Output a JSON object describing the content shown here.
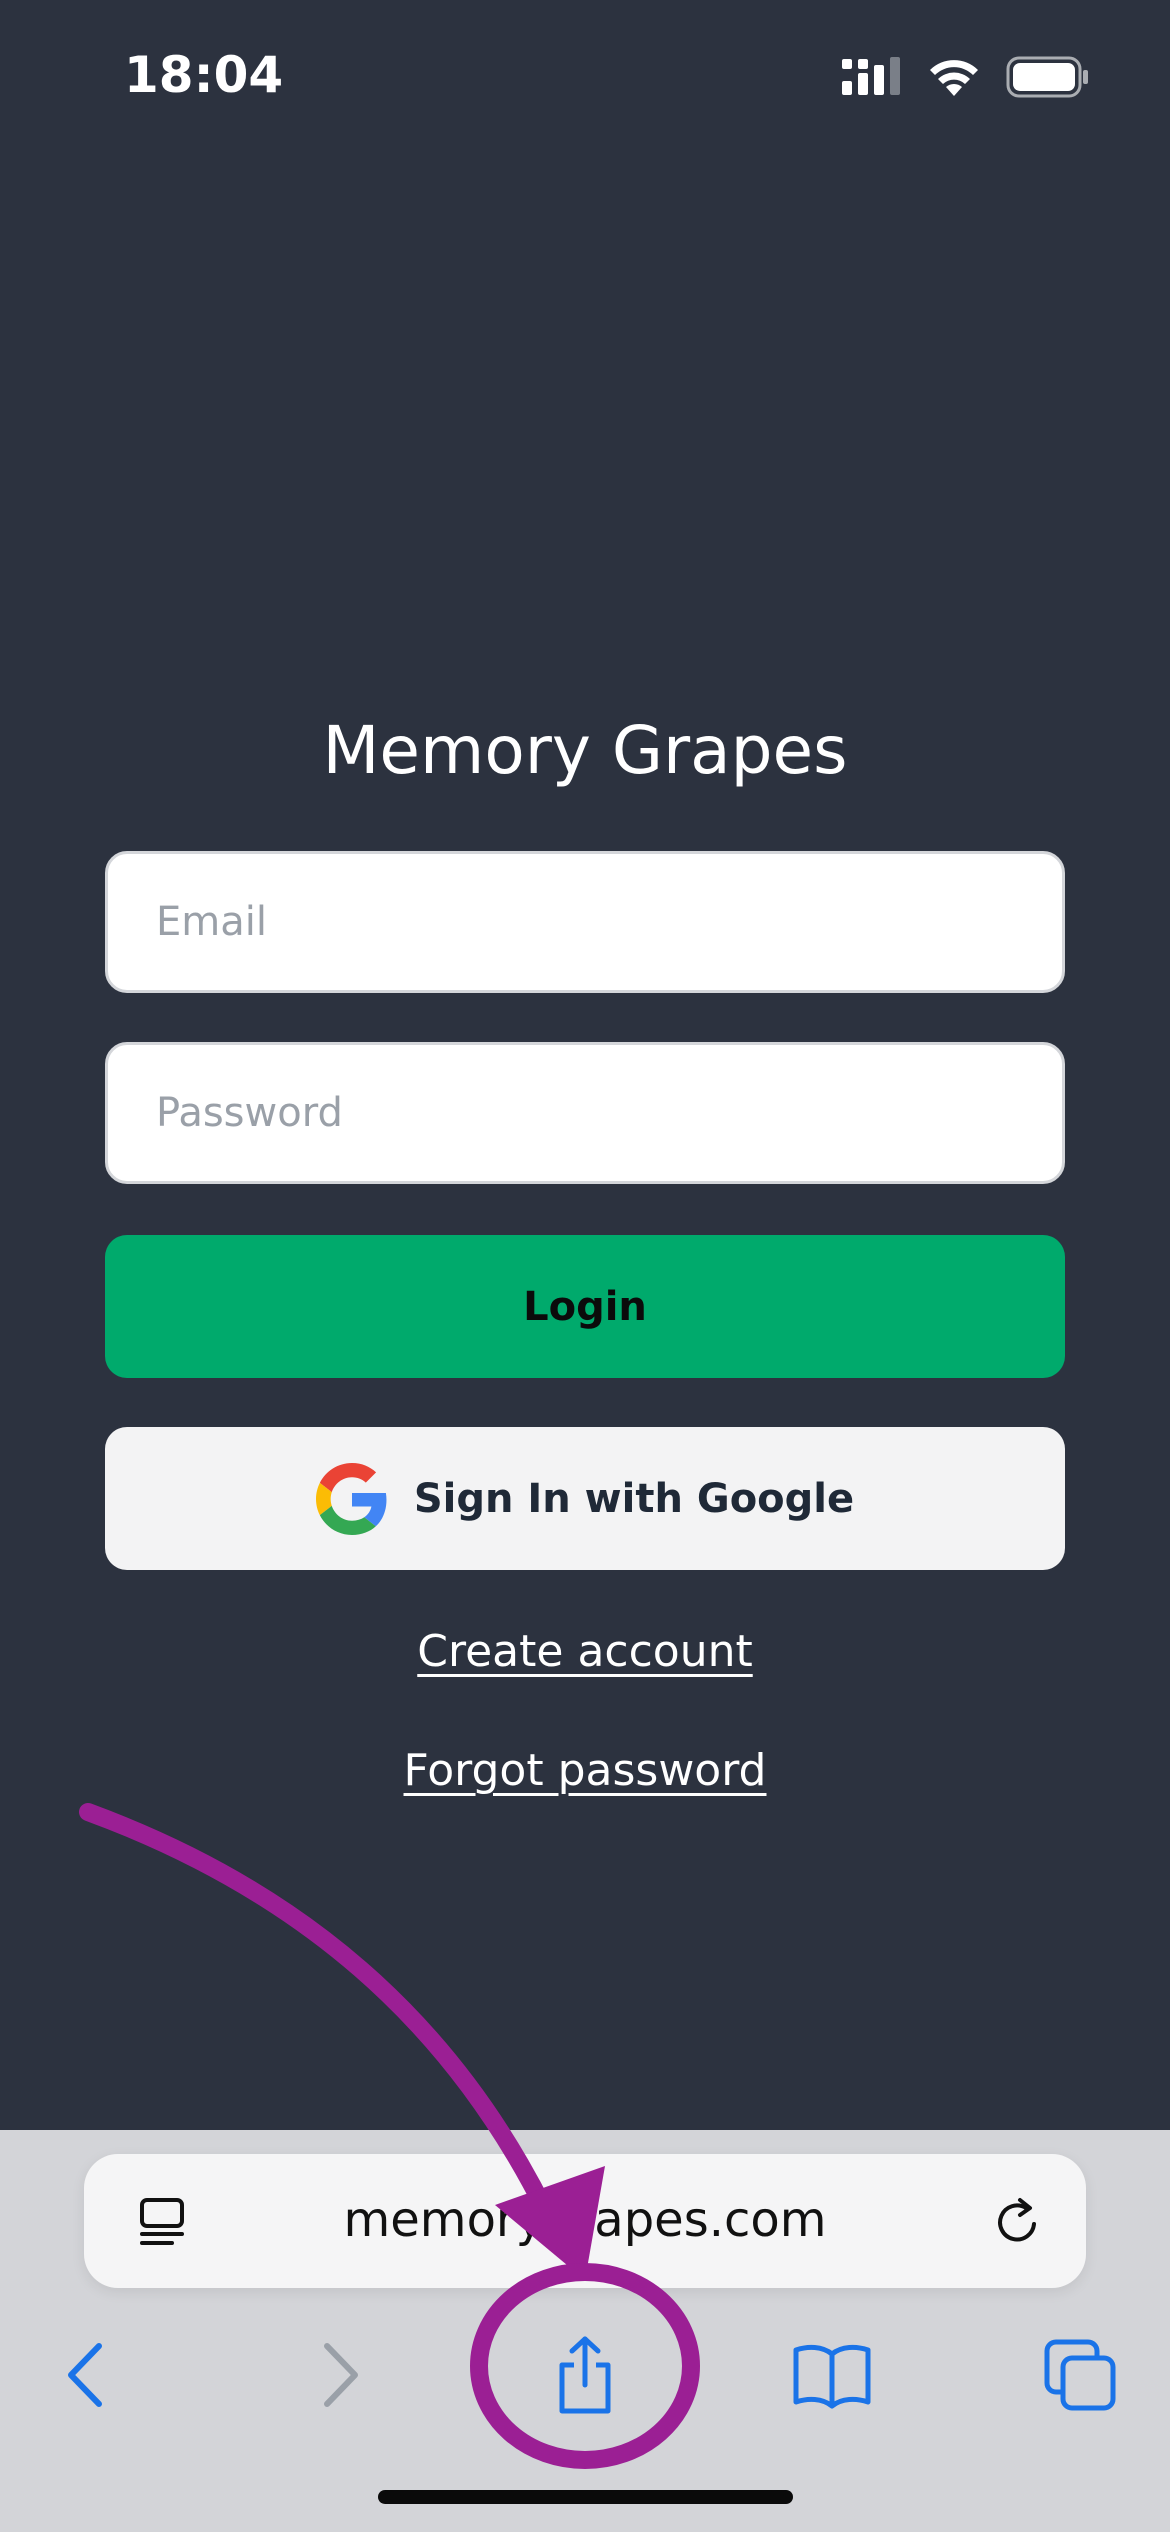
{
  "status_bar": {
    "time": "18:04"
  },
  "app": {
    "title": "Memory Grapes"
  },
  "form": {
    "email_placeholder": "Email",
    "email_value": "",
    "password_placeholder": "Password",
    "password_value": "",
    "login_label": "Login",
    "google_label": "Sign In with Google",
    "create_account_label": "Create account",
    "forgot_password_label": "Forgot password"
  },
  "browser": {
    "url": "memorygrapes.com",
    "icons": {
      "page_menu": "page-menu-icon",
      "reload": "reload-icon",
      "back": "chevron-left-icon",
      "forward": "chevron-right-icon",
      "share": "share-icon",
      "bookmarks": "book-icon",
      "tabs": "tabs-icon"
    }
  },
  "colors": {
    "background": "#2c323f",
    "login_button": "#00aa6c",
    "google_button": "#f3f3f4",
    "toolbar_accent": "#1a73e8",
    "annotation": "#9b1f94"
  }
}
